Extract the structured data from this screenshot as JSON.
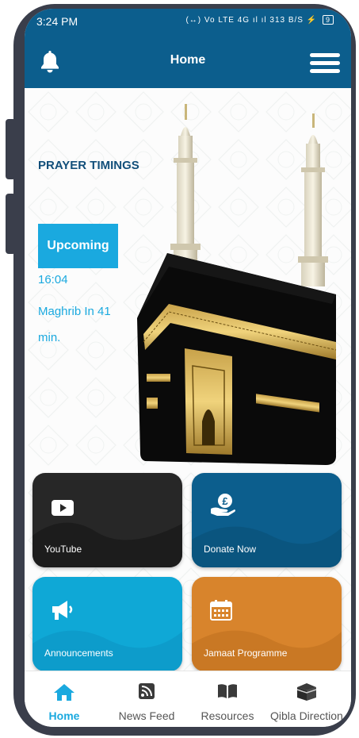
{
  "status_bar": {
    "time": "3:24 PM",
    "icons": "(↔) Vo LTE 4G ıl ıl 313 B/S",
    "battery": "9"
  },
  "header": {
    "title": "Home",
    "left_icon": "bell-icon",
    "right_icon": "hamburger-menu-icon",
    "color": "#0c5e8d"
  },
  "prayer": {
    "title": "PRAYER TIMINGS",
    "upcoming_label": "Upcoming",
    "time": "16:04",
    "next_text": "Maghrib In 41 min."
  },
  "tiles": [
    {
      "label": "YouTube",
      "icon": "youtube-icon",
      "color": "#272727"
    },
    {
      "label": "Donate Now",
      "icon": "donate-pound-hand-icon",
      "color": "#0c5e8d"
    },
    {
      "label": "Announcements",
      "icon": "megaphone-icon",
      "color": "#0fa8d6"
    },
    {
      "label": "Jamaat Programme",
      "icon": "calendar-icon",
      "color": "#d8842c"
    }
  ],
  "nav": [
    {
      "label": "Home",
      "icon": "home-icon",
      "active": true
    },
    {
      "label": "News Feed",
      "icon": "rss-feed-icon",
      "active": false
    },
    {
      "label": "Resources",
      "icon": "book-icon",
      "active": false
    },
    {
      "label": "Qibla Direction",
      "icon": "kaaba-icon",
      "active": false
    }
  ],
  "colors": {
    "accent": "#1aa9df",
    "primary": "#0c5e8d"
  }
}
